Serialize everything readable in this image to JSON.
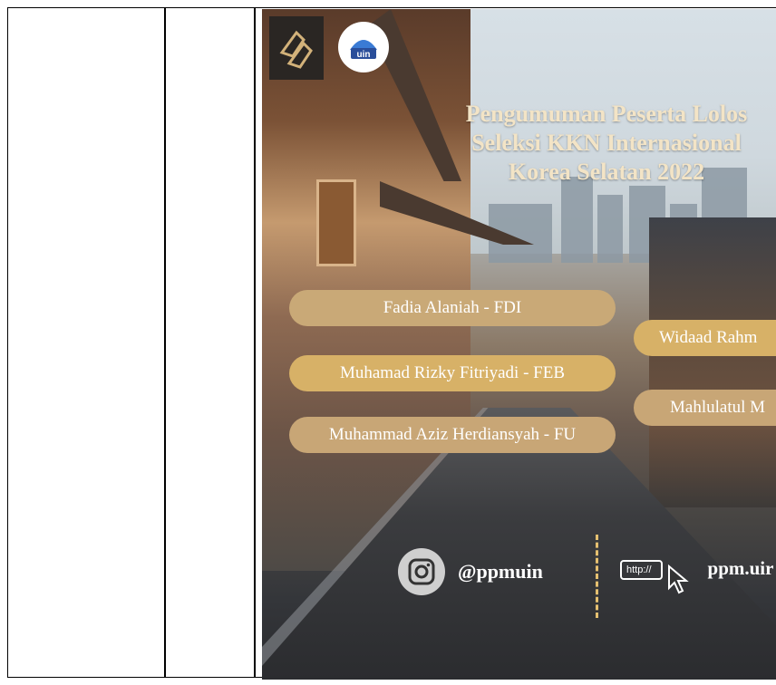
{
  "poster": {
    "title_lines": [
      "Pengumuman Peserta Lolos",
      "Seleksi KKN Internasional",
      "Korea Selatan 2022"
    ],
    "names": [
      "Fadia Alaniah - FDI",
      "Muhamad Rizky Fitriyadi - FEB",
      "Muhammad Aziz Herdiansyah - FU",
      "Widaad Rahm",
      "Mahlulatul M"
    ],
    "instagram_handle": "@ppmuin",
    "http_label": "http://",
    "website": "ppm.uir",
    "logo_uin_text": "uin"
  },
  "colors": {
    "title": "#f3e4c6",
    "pill_gold": "#d7b167",
    "pill_tan": "#c9a977",
    "divider": "#e5c070"
  }
}
